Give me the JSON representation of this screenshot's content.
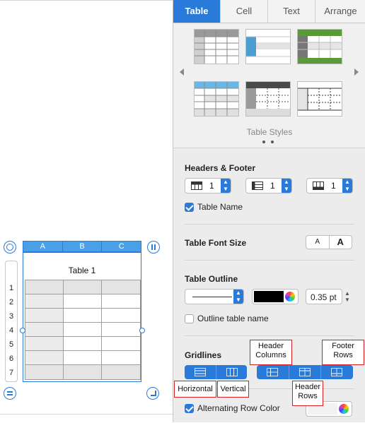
{
  "tabs": [
    {
      "label": "Table",
      "active": true
    },
    {
      "label": "Cell",
      "active": false
    },
    {
      "label": "Text",
      "active": false
    },
    {
      "label": "Arrange",
      "active": false
    }
  ],
  "table_styles": {
    "label": "Table Styles",
    "page_count": 2,
    "current_page": 1
  },
  "headers_footer": {
    "title": "Headers & Footer",
    "header_rows": "1",
    "header_columns": "1",
    "footer_rows": "1",
    "table_name_label": "Table Name",
    "table_name_checked": true
  },
  "font_size": {
    "title": "Table Font Size",
    "smaller": "A",
    "larger": "A"
  },
  "outline": {
    "title": "Table Outline",
    "width": "0.35 pt",
    "outline_name_label": "Outline table name",
    "outline_name_checked": false
  },
  "gridlines": {
    "title": "Gridlines"
  },
  "alternating": {
    "label": "Alternating Row Color",
    "checked": true
  },
  "annotations": {
    "header_columns": "Header\nColumns",
    "footer_rows": "Footer\nRows",
    "horizontal": "Horizontal",
    "vertical": "Vertical",
    "header_rows": "Header\nRows"
  },
  "table": {
    "title": "Table 1",
    "columns": [
      "A",
      "B",
      "C"
    ],
    "rows": [
      "1",
      "2",
      "3",
      "4",
      "5",
      "6",
      "7"
    ]
  },
  "colors": {
    "accent": "#2a7ad9",
    "annotation_border": "#d81f1f"
  }
}
